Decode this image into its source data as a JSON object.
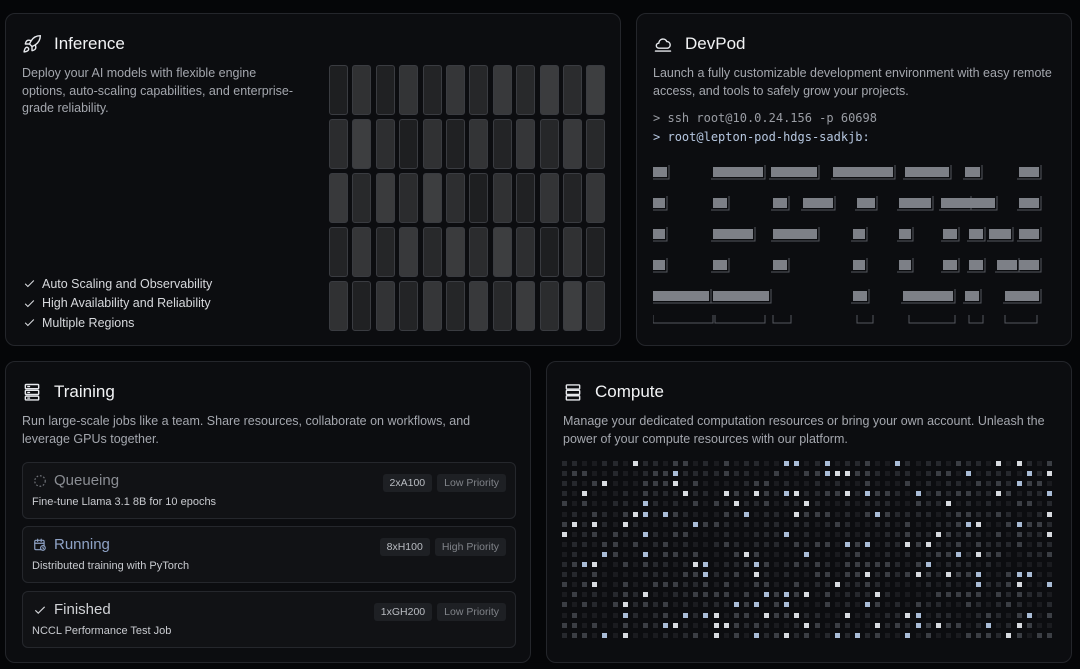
{
  "inference": {
    "title": "Inference",
    "icon": "rocket-icon",
    "description": "Deploy your AI models with flexible engine options, auto-scaling capabilities, and enterprise-grade reliability.",
    "features": [
      "Auto Scaling and Observability",
      "High Availability and Reliability",
      "Multiple Regions"
    ]
  },
  "devpod": {
    "title": "DevPod",
    "icon": "cloud-icon",
    "description": "Launch a fully customizable development environment with easy remote access, and tools to safely grow your projects.",
    "terminal": [
      {
        "prompt": ">",
        "text": "ssh root@10.0.24.156 -p 60698"
      },
      {
        "prompt": ">",
        "text": "root@lepton-pod-hdgs-sadkjb:"
      }
    ]
  },
  "training": {
    "title": "Training",
    "icon": "server-stack-icon",
    "description": "Run large-scale jobs like a team. Share resources, collaborate on workflows, and leverage GPUs together.",
    "jobs": [
      {
        "status": "Queueing",
        "icon": "spinner-icon",
        "desc": "Fine-tune Llama 3.1 8B for 10 epochs",
        "gpu": "2xA100",
        "priority": "Low Priority",
        "color": "#8a8d93"
      },
      {
        "status": "Running",
        "icon": "calendar-clock-icon",
        "desc": "Distributed training with PyTorch",
        "gpu": "8xH100",
        "priority": "High Priority",
        "color": "#8fa3c6"
      },
      {
        "status": "Finished",
        "icon": "check-icon",
        "desc": "NCCL Performance Test Job",
        "gpu": "1xGH200",
        "priority": "Low Priority",
        "color": "#d0d2d6"
      }
    ]
  },
  "compute": {
    "title": "Compute",
    "icon": "server-icon",
    "description": "Manage your dedicated computation resources or bring your own account. Unleash the power of your compute resources with our platform."
  },
  "colors": {
    "background": "#050608",
    "card": "#0c0d10",
    "accent": "#a8bcd8"
  }
}
